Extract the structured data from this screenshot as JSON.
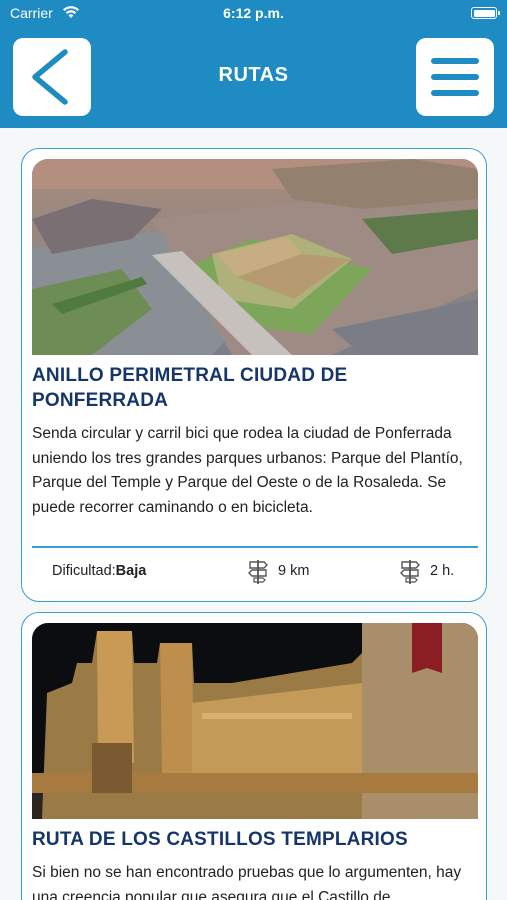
{
  "status_bar": {
    "carrier": "Carrier",
    "time": "6:12 p.m."
  },
  "header": {
    "title": "RUTAS"
  },
  "routes": [
    {
      "title": "ANILLO PERIMETRAL CIUDAD DE PONFERRADA",
      "description": "Senda circular y carril bici que rodea la ciudad de Ponferrada uniendo los tres grandes parques urbanos: Parque del Plantío, Parque del Temple y Parque del Oeste o de la Rosaleda. Se puede recorrer caminando o en bicicleta.",
      "difficulty_label": "Dificultad:",
      "difficulty_value": "Baja",
      "distance": "9 km",
      "duration": "2 h."
    },
    {
      "title": "RUTA DE LOS CASTILLOS TEMPLARIOS",
      "description": "Si bien no se han encontrado pruebas que lo argumenten, hay una creencia popular que asegura que el Castillo de"
    }
  ],
  "colors": {
    "brand": "#1e8bc3",
    "title": "#16366a",
    "card_border": "#3b9ed1"
  },
  "icons": {
    "back": "chevron-left-icon",
    "menu": "hamburger-menu-icon",
    "distance": "signpost-icon",
    "duration": "signpost-icon"
  }
}
